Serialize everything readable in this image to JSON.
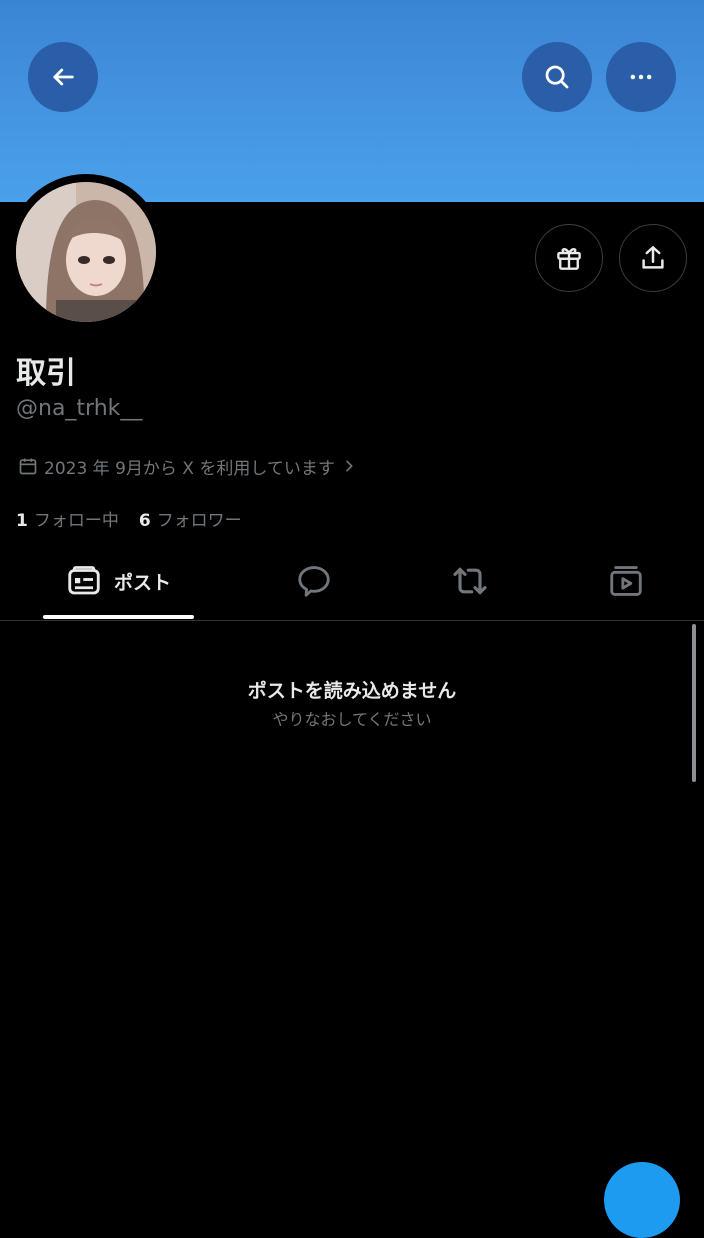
{
  "header": {
    "back_icon": "arrow-left-icon",
    "search_icon": "search-icon",
    "more_icon": "more-horizontal-icon",
    "banner_color": "#4596e2",
    "button_bg": "#2a5ea8"
  },
  "profile": {
    "display_name": "取引",
    "handle": "@na_trhk__",
    "joined": "2023 年 9月から X を利用しています",
    "following_count": "1",
    "following_label": "フォロー中",
    "followers_count": "6",
    "followers_label": "フォロワー",
    "gift_icon": "gift-icon",
    "share_icon": "share-icon"
  },
  "tabs": {
    "posts_label": "ポスト",
    "posts_icon": "posts-icon",
    "replies_icon": "reply-bubble-icon",
    "reposts_icon": "repost-icon",
    "media_icon": "media-icon"
  },
  "empty_state": {
    "title": "ポストを読み込めません",
    "subtitle": "やりなおしてください"
  },
  "colors": {
    "background": "#000000",
    "primary_text": "#e7e9ea",
    "secondary_text": "#71767b",
    "accent": "#1d9bf0"
  }
}
